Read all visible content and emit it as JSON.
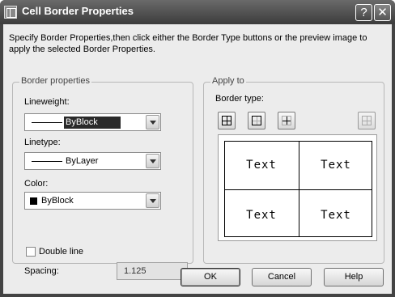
{
  "window": {
    "title": "Cell Border Properties",
    "help_glyph": "?",
    "close_glyph": "✕"
  },
  "description": "Specify Border Properties,then click either the Border Type buttons or the preview image to apply the selected Border Properties.",
  "border_properties": {
    "legend": "Border properties",
    "lineweight": {
      "label": "Lineweight:",
      "value": "ByBlock"
    },
    "linetype": {
      "label": "Linetype:",
      "value": "ByLayer"
    },
    "color": {
      "label": "Color:",
      "value": "ByBlock",
      "swatch": "#000000"
    },
    "double_line": {
      "label": "Double line",
      "checked": false
    },
    "spacing": {
      "label": "Spacing:",
      "value": "1.125"
    }
  },
  "apply_to": {
    "legend": "Apply to",
    "border_type_label": "Border type:",
    "border_types": [
      "all-borders-icon",
      "outside-borders-icon",
      "inside-borders-icon",
      "no-borders-icon"
    ],
    "preview_cells": [
      "Text",
      "Text",
      "Text",
      "Text"
    ]
  },
  "buttons": {
    "ok": "OK",
    "cancel": "Cancel",
    "help": "Help"
  }
}
